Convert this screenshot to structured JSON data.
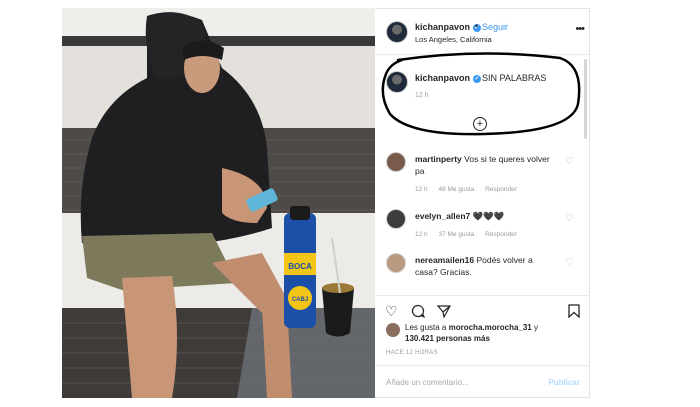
{
  "post": {
    "username": "kichanpavon",
    "follow_label": "Seguir",
    "separator": "•",
    "location": "Los Angeles, California",
    "more_icon": "more-options-icon",
    "caption_text": "SIN PALABRAS",
    "caption_time": "12 h",
    "load_more_icon": "plus-circle-icon"
  },
  "comments": [
    {
      "user": "martinperty",
      "text": "Vos si te queres volver pa",
      "time": "12 h",
      "likes": "48 Me gusta",
      "reply": "Responder"
    },
    {
      "user": "evelyn_allen7",
      "text": "🖤🖤🖤",
      "time": "12 h",
      "likes": "37 Me gusta",
      "reply": "Responder"
    },
    {
      "user": "nereamailen16",
      "text": "Podés volver a casa? Gracias.",
      "time": "",
      "likes": "",
      "reply": ""
    }
  ],
  "actions": {
    "like_icon": "heart-icon",
    "comment_icon": "comment-icon",
    "share_icon": "share-icon",
    "save_icon": "bookmark-icon"
  },
  "likes": {
    "prefix": "Les gusta a",
    "user": "morocha.morocha_31",
    "joiner": "y",
    "count": "130.421 personas más"
  },
  "post_date": "HACE 12 HORAS",
  "add_comment": {
    "placeholder": "Añade un comentario...",
    "publish_label": "Publicar"
  },
  "photo": {
    "bottle_text_top": "BOCA",
    "bottle_text_bottom": "CABJ"
  },
  "colors": {
    "link": "#3897f0",
    "muted": "#9a9a9a",
    "publish_disabled": "#b3dbff"
  }
}
